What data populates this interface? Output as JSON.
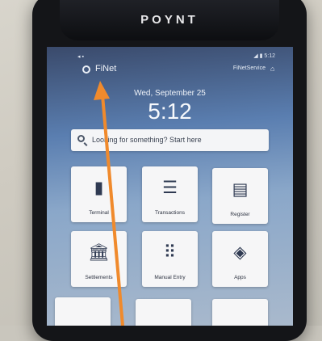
{
  "brand": "POYNT",
  "status": {
    "left_icons": "◂ ▪",
    "right_text": "◢ ▮ 5:12"
  },
  "appbar": {
    "merchant": "FiNet",
    "service": "FiNetService"
  },
  "lock": {
    "date": "Wed, September 25",
    "time": "5:12"
  },
  "search": {
    "placeholder": "Looking for something? Start here"
  },
  "tiles": [
    {
      "label": "Terminal",
      "icon": "terminal-icon",
      "glyph": "▮"
    },
    {
      "label": "Transactions",
      "icon": "list-icon",
      "glyph": "☰"
    },
    {
      "label": "Register",
      "icon": "register-icon",
      "glyph": "▤"
    },
    {
      "label": "Settlements",
      "icon": "bank-icon",
      "glyph": "🏛"
    },
    {
      "label": "Manual Entry",
      "icon": "keypad-icon",
      "glyph": "⠿"
    },
    {
      "label": "Apps",
      "icon": "layers-icon",
      "glyph": "◈"
    }
  ],
  "colors": {
    "arrow": "#f08a2c",
    "screen_top": "#3a4a6b",
    "tile": "#f6f6f7"
  }
}
